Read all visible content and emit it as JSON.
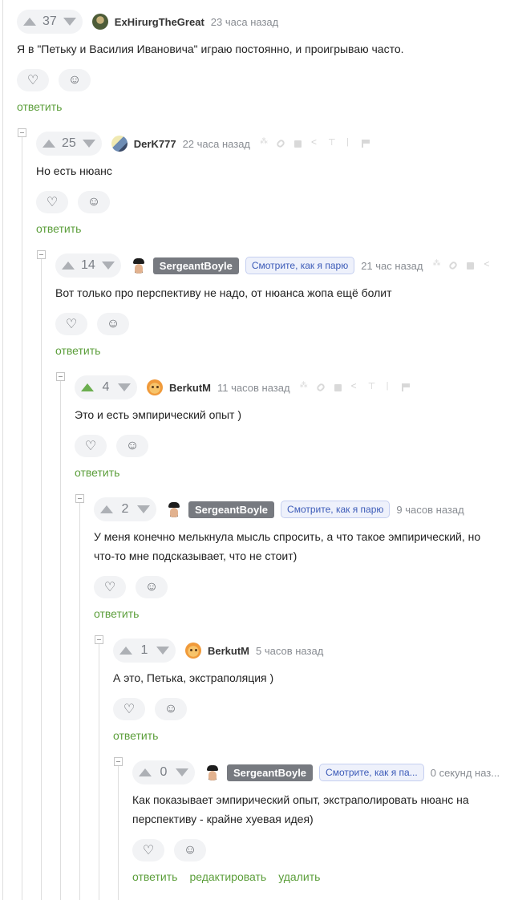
{
  "reply_label": "ответить",
  "edit_label": "редактировать",
  "delete_label": "удалить",
  "accent_color": "#5b9e3a",
  "icons": {
    "like": "heart-icon",
    "react": "smiley-plus-icon",
    "upvote": "arrow-up-icon",
    "downvote": "arrow-down-icon"
  },
  "comments": [
    {
      "score": "37",
      "author": "ExHirurgTheGreat",
      "time": "23 часа назад",
      "text": [
        "Я в \"Петьку и Василия Ивановича\" играю постоянно, и проигрываю часто."
      ]
    },
    {
      "score": "25",
      "author": "DerK777",
      "time": "22 часа назад",
      "text": [
        "Но есть нюанс"
      ]
    },
    {
      "score": "14",
      "author": "SergeantBoyle",
      "note": "Смотрите, как я парю",
      "time": "21 час назад",
      "text": [
        "Вот только про перспективу не надо, от нюанса жопа ещё болит"
      ]
    },
    {
      "score": "4",
      "author": "BerkutM",
      "time": "11 часов назад",
      "text": [
        "Это и есть эмпирический опыт )"
      ],
      "upvoted": true
    },
    {
      "score": "2",
      "author": "SergeantBoyle",
      "note": "Смотрите, как я парю",
      "time": "9 часов назад",
      "text": [
        "У меня конечно мелькнула мысль спросить, а что такое эмпирический, но",
        "что-то мне подсказывает, что не стоит)"
      ]
    },
    {
      "score": "1",
      "author": "BerkutM",
      "time": "5 часов назад",
      "text": [
        "А это, Петька, экстраполяция )"
      ]
    },
    {
      "score": "0",
      "author": "SergeantBoyle",
      "note": "Смотрите, как я па...",
      "time": "0 секунд наз...",
      "text": [
        "Как показывает эмпирический опыт, экстраполировать нюанс на",
        "перспективу - крайне хуевая идея)"
      ]
    }
  ]
}
